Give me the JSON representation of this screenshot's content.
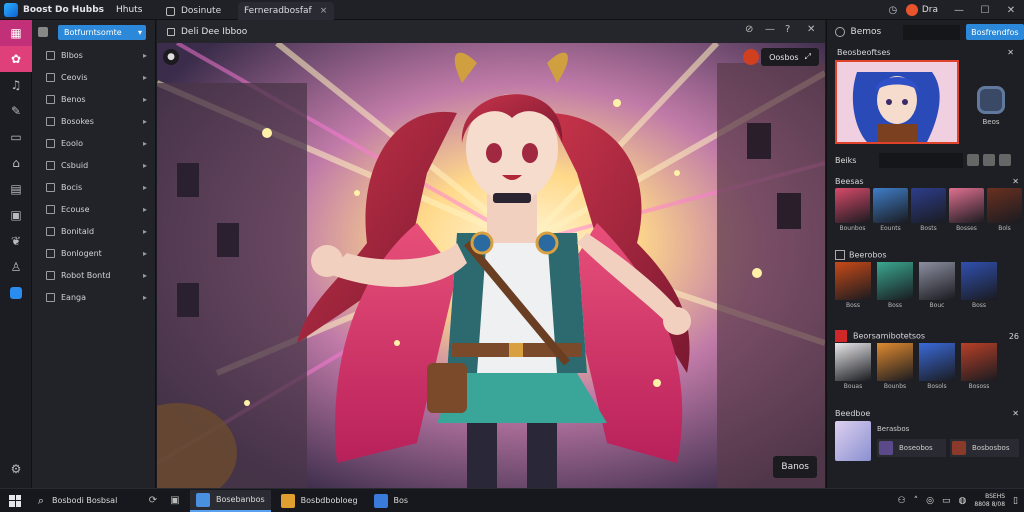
{
  "app": {
    "title": "Boost Do Hubbs",
    "subtitle": "Hhuts"
  },
  "tabs": [
    {
      "label": "Dosinute"
    },
    {
      "label": "Ferneradbosfaf"
    }
  ],
  "account": {
    "name": "Dra"
  },
  "layers": {
    "dropdown_label": "Botfurntsomte",
    "items": [
      {
        "label": "Blbos"
      },
      {
        "label": "Ceovis"
      },
      {
        "label": "Benos"
      },
      {
        "label": "Bosokes"
      },
      {
        "label": "Eoolo"
      },
      {
        "label": "Csbuid"
      },
      {
        "label": "Bocis"
      },
      {
        "label": "Ecouse"
      },
      {
        "label": "Bonitald"
      },
      {
        "label": "Bonlogent"
      },
      {
        "label": "Robot Bontd"
      },
      {
        "label": "Eanga"
      }
    ]
  },
  "canvas": {
    "title": "Deli Dee Ibboo",
    "compare_label": "Oosbos",
    "action_button": "Banos"
  },
  "right_panel": {
    "top_label": "Bemos",
    "top_button": "Bosfrendfos",
    "preview_title": "Beosbeoftses",
    "preview_side_label": "Beos",
    "search_label": "Beiks",
    "section1": {
      "title": "Beesas",
      "items": [
        {
          "caption": "Bounbos",
          "color": "#d84a6a"
        },
        {
          "caption": "Eounts",
          "color": "#3f7ec8"
        },
        {
          "caption": "Bosts",
          "color": "#2d3e8c"
        },
        {
          "caption": "Bosses",
          "color": "#e07090"
        },
        {
          "caption": "Bols",
          "color": "#6a3020"
        }
      ]
    },
    "section2": {
      "title": "Beerobos",
      "items": [
        {
          "caption": "Boss",
          "color": "#c84a18"
        },
        {
          "caption": "Boss",
          "color": "#3aa890"
        },
        {
          "caption": "Bouc",
          "color": "#8c8fa0"
        },
        {
          "caption": "Boss",
          "color": "#3050b0"
        }
      ]
    },
    "section3": {
      "title": "Beorsamibotetsos",
      "count": "26",
      "items": [
        {
          "caption": "Bouas",
          "color": "#e8e8ea"
        },
        {
          "caption": "Bounbs",
          "color": "#e08a30"
        },
        {
          "caption": "Bosols",
          "color": "#3a6ad8"
        },
        {
          "caption": "Bososs",
          "color": "#b84028"
        }
      ]
    },
    "section4": {
      "title": "Beedboe",
      "row1_title": "Berasbos",
      "row2_a": "Boseobos",
      "row2_b": "Bosbosbos"
    }
  },
  "taskbar": {
    "search_text": "Bosbodi Bosbsal",
    "apps": [
      {
        "label": "Bosebanbos",
        "color": "#4a90e0"
      },
      {
        "label": "Bosbdbobloeg",
        "color": "#e0a030"
      },
      {
        "label": "Bos",
        "color": "#3a7ad8"
      }
    ],
    "clock_time": "BSEHS",
    "clock_date": "8808 8/08"
  },
  "colors": {
    "accent_blue": "#2c88d8",
    "accent_magenta": "#c2307a",
    "selection_red": "#e0432b"
  }
}
